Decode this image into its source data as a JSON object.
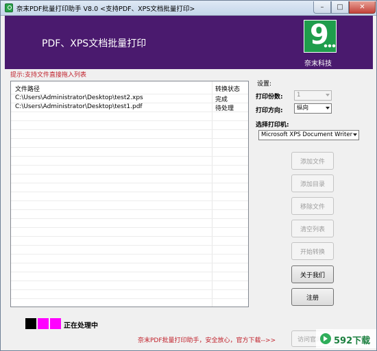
{
  "window": {
    "title": "奈末PDF批量打印助手 V8.0    <支持PDF、XPS文档批量打印>",
    "minimize": "–",
    "maximize": "□",
    "close": "✕"
  },
  "banner": {
    "title": "PDF、XPS文档批量打印",
    "logo_text": "9",
    "company": "奈末科技"
  },
  "hint": "提示:支持文件直接拖入列表",
  "file_list": {
    "columns": [
      "文件路径",
      "转换状态"
    ],
    "rows": [
      {
        "path": "C:\\Users\\Administrator\\Desktop\\test2.xps",
        "status": "完成"
      },
      {
        "path": "C:\\Users\\Administrator\\Desktop\\test1.pdf",
        "status": "待处理"
      }
    ]
  },
  "settings": {
    "label": "设置:",
    "copies_label": "打印份数:",
    "copies_value": "1",
    "orientation_label": "打印方向:",
    "orientation_value": "纵向",
    "printer_label": "选择打印机:",
    "printer_value": "Microsoft XPS Document Writer"
  },
  "buttons": {
    "add_file": "添加文件",
    "add_dir": "添加目录",
    "remove_file": "移除文件",
    "clear_list": "清空列表",
    "start": "开始转换",
    "about": "关于我们",
    "register": "注册"
  },
  "status": {
    "text": "正在处理中",
    "colors": [
      "#000000",
      "#ff00ff",
      "#ff00ff"
    ]
  },
  "footer": {
    "link_text": "奈末PDF批量打印助手，安全放心，官方下载-->>",
    "visit_button": "访问官网"
  },
  "watermark": {
    "text": "592下载"
  }
}
